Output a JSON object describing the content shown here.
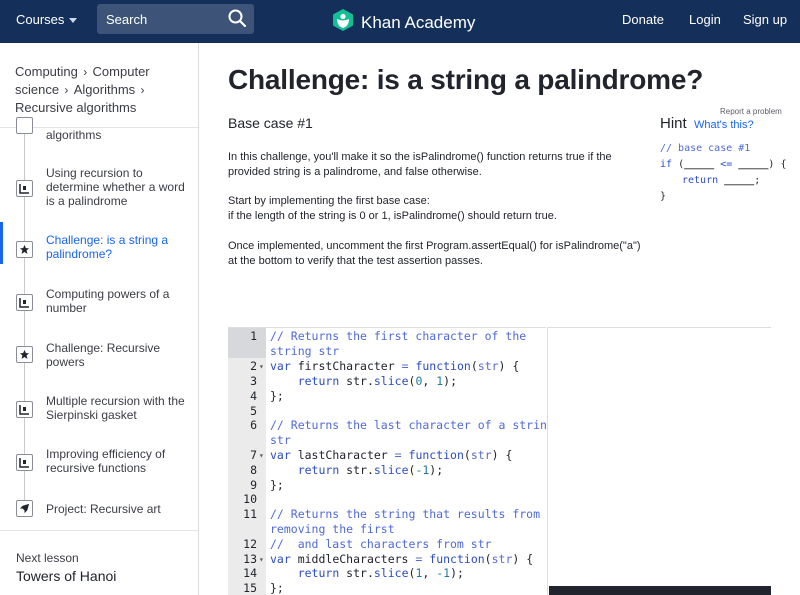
{
  "nav": {
    "courses": "Courses",
    "search_label": "Search",
    "logo_text": "Khan Academy",
    "donate": "Donate",
    "login": "Login",
    "signup": "Sign up"
  },
  "breadcrumb": [
    "Computing",
    "Computer science",
    "Algorithms",
    "Recursive algorithms"
  ],
  "sidebar": {
    "items": [
      {
        "label": "algorithms",
        "icon": "article-icon"
      },
      {
        "label": "Using recursion to determine whether a word is a palindrome",
        "icon": "article-icon"
      },
      {
        "label": "Challenge: is a string a palindrome?",
        "icon": "star-icon",
        "active": true
      },
      {
        "label": "Computing powers of a number",
        "icon": "article-icon"
      },
      {
        "label": "Challenge: Recursive powers",
        "icon": "star-icon"
      },
      {
        "label": "Multiple recursion with the Sierpinski gasket",
        "icon": "article-icon"
      },
      {
        "label": "Improving efficiency of recursive functions",
        "icon": "article-icon"
      },
      {
        "label": "Project: Recursive art",
        "icon": "rocket-icon"
      }
    ],
    "next_label": "Next lesson",
    "next_title": "Towers of Hanoi"
  },
  "main": {
    "title": "Challenge: is a string a palindrome?",
    "report": "Report a problem",
    "step_title": "Base case #1",
    "p1": "In this challenge, you'll make it so the isPalindrome() function returns true if the provided string is a palindrome, and false otherwise.",
    "p2a": "Start by implementing the first base case:",
    "p2b": "if the length of the string is 0 or 1, isPalindrome() should return true.",
    "p3": "Once implemented, uncomment the first Program.assertEqual() for isPalindrome(\"a\") at the bottom to verify that the test assertion passes."
  },
  "hint": {
    "title": "Hint",
    "whats_this": "What's this?",
    "l1": "// base case #1",
    "l2_kw": "if",
    "l2_a": " (",
    "l2_b1": "_____",
    "l2_c": " <= ",
    "l2_b2": "_____",
    "l2_d": ") {",
    "l3_kw": "return",
    "l3_b": "_____",
    "l3_e": ";",
    "l4": "}"
  },
  "colors": {
    "nav_bg": "#14305a",
    "accent": "#1865f2",
    "logo_green": "#14bf96"
  }
}
